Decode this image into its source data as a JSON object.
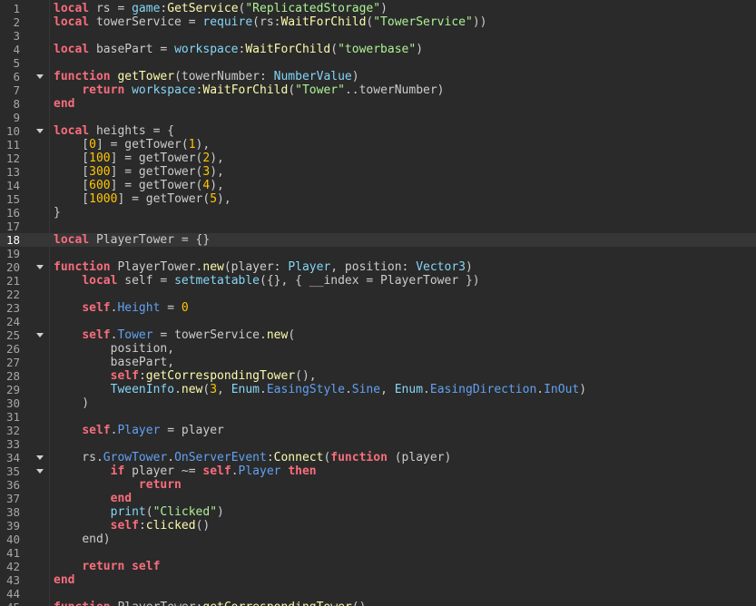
{
  "editor": {
    "current_line": 18,
    "lines": [
      {
        "n": "1",
        "tokens": [
          [
            "kw",
            "local"
          ],
          [
            "plain",
            " rs = "
          ],
          [
            "bi",
            "game"
          ],
          [
            "op",
            ":"
          ],
          [
            "meth",
            "GetService"
          ],
          [
            "plain",
            "("
          ],
          [
            "str",
            "\"ReplicatedStorage\""
          ],
          [
            "plain",
            ")"
          ]
        ]
      },
      {
        "n": "2",
        "tokens": [
          [
            "kw",
            "local"
          ],
          [
            "plain",
            " towerService = "
          ],
          [
            "bi",
            "require"
          ],
          [
            "plain",
            "(rs:"
          ],
          [
            "meth",
            "WaitForChild"
          ],
          [
            "plain",
            "("
          ],
          [
            "str",
            "\"TowerService\""
          ],
          [
            "plain",
            "))"
          ]
        ]
      },
      {
        "n": "3",
        "tokens": []
      },
      {
        "n": "4",
        "tokens": [
          [
            "kw",
            "local"
          ],
          [
            "plain",
            " basePart = "
          ],
          [
            "bi",
            "workspace"
          ],
          [
            "op",
            ":"
          ],
          [
            "meth",
            "WaitForChild"
          ],
          [
            "plain",
            "("
          ],
          [
            "str",
            "\"towerbase\""
          ],
          [
            "plain",
            ")"
          ]
        ]
      },
      {
        "n": "5",
        "tokens": []
      },
      {
        "n": "6",
        "fold": true,
        "tokens": [
          [
            "kw",
            "function"
          ],
          [
            "plain",
            " "
          ],
          [
            "fn",
            "getTower"
          ],
          [
            "plain",
            "(towerNumber: "
          ],
          [
            "type",
            "NumberValue"
          ],
          [
            "plain",
            ")"
          ]
        ]
      },
      {
        "n": "7",
        "tokens": [
          [
            "plain",
            "    "
          ],
          [
            "kw",
            "return"
          ],
          [
            "plain",
            " "
          ],
          [
            "bi",
            "workspace"
          ],
          [
            "op",
            ":"
          ],
          [
            "meth",
            "WaitForChild"
          ],
          [
            "plain",
            "("
          ],
          [
            "str",
            "\"Tower\""
          ],
          [
            "plain",
            "..towerNumber)"
          ]
        ]
      },
      {
        "n": "8",
        "tokens": [
          [
            "kw",
            "end"
          ]
        ]
      },
      {
        "n": "9",
        "tokens": []
      },
      {
        "n": "10",
        "fold": true,
        "tokens": [
          [
            "kw",
            "local"
          ],
          [
            "plain",
            " heights = {"
          ]
        ]
      },
      {
        "n": "11",
        "tokens": [
          [
            "plain",
            "    ["
          ],
          [
            "num",
            "0"
          ],
          [
            "plain",
            "] = getTower("
          ],
          [
            "num",
            "1"
          ],
          [
            "plain",
            "),"
          ]
        ]
      },
      {
        "n": "12",
        "tokens": [
          [
            "plain",
            "    ["
          ],
          [
            "num",
            "100"
          ],
          [
            "plain",
            "] = getTower("
          ],
          [
            "num",
            "2"
          ],
          [
            "plain",
            "),"
          ]
        ]
      },
      {
        "n": "13",
        "tokens": [
          [
            "plain",
            "    ["
          ],
          [
            "num",
            "300"
          ],
          [
            "plain",
            "] = getTower("
          ],
          [
            "num",
            "3"
          ],
          [
            "plain",
            "),"
          ]
        ]
      },
      {
        "n": "14",
        "tokens": [
          [
            "plain",
            "    ["
          ],
          [
            "num",
            "600"
          ],
          [
            "plain",
            "] = getTower("
          ],
          [
            "num",
            "4"
          ],
          [
            "plain",
            "),"
          ]
        ]
      },
      {
        "n": "15",
        "tokens": [
          [
            "plain",
            "    ["
          ],
          [
            "num",
            "1000"
          ],
          [
            "plain",
            "] = getTower("
          ],
          [
            "num",
            "5"
          ],
          [
            "plain",
            "),"
          ]
        ]
      },
      {
        "n": "16",
        "tokens": [
          [
            "plain",
            "}"
          ]
        ]
      },
      {
        "n": "17",
        "tokens": []
      },
      {
        "n": "18",
        "tokens": [
          [
            "kw",
            "local"
          ],
          [
            "plain",
            " PlayerTower = {}"
          ]
        ]
      },
      {
        "n": "19",
        "tokens": []
      },
      {
        "n": "20",
        "fold": true,
        "tokens": [
          [
            "kw",
            "function"
          ],
          [
            "plain",
            " PlayerTower."
          ],
          [
            "fn",
            "new"
          ],
          [
            "plain",
            "(player: "
          ],
          [
            "type",
            "Player"
          ],
          [
            "plain",
            ", position: "
          ],
          [
            "type",
            "Vector3"
          ],
          [
            "plain",
            ")"
          ]
        ]
      },
      {
        "n": "21",
        "tokens": [
          [
            "plain",
            "    "
          ],
          [
            "kw",
            "local"
          ],
          [
            "plain",
            " self = "
          ],
          [
            "bi",
            "setmetatable"
          ],
          [
            "plain",
            "({}, { __index = PlayerTower })"
          ]
        ]
      },
      {
        "n": "22",
        "tokens": []
      },
      {
        "n": "23",
        "tokens": [
          [
            "plain",
            "    "
          ],
          [
            "self",
            "self"
          ],
          [
            "plain",
            "."
          ],
          [
            "prop",
            "Height"
          ],
          [
            "plain",
            " = "
          ],
          [
            "num",
            "0"
          ]
        ]
      },
      {
        "n": "24",
        "tokens": []
      },
      {
        "n": "25",
        "fold": true,
        "tokens": [
          [
            "plain",
            "    "
          ],
          [
            "self",
            "self"
          ],
          [
            "plain",
            "."
          ],
          [
            "prop",
            "Tower"
          ],
          [
            "plain",
            " = towerService."
          ],
          [
            "fn",
            "new"
          ],
          [
            "plain",
            "("
          ]
        ]
      },
      {
        "n": "26",
        "tokens": [
          [
            "plain",
            "        position,"
          ]
        ]
      },
      {
        "n": "27",
        "tokens": [
          [
            "plain",
            "        basePart,"
          ]
        ]
      },
      {
        "n": "28",
        "tokens": [
          [
            "plain",
            "        "
          ],
          [
            "self",
            "self"
          ],
          [
            "plain",
            ":"
          ],
          [
            "fn",
            "getCorrespondingTower"
          ],
          [
            "plain",
            "(),"
          ]
        ]
      },
      {
        "n": "29",
        "tokens": [
          [
            "plain",
            "        "
          ],
          [
            "bi",
            "TweenInfo"
          ],
          [
            "plain",
            "."
          ],
          [
            "meth",
            "new"
          ],
          [
            "plain",
            "("
          ],
          [
            "num",
            "3"
          ],
          [
            "plain",
            ", "
          ],
          [
            "bi",
            "Enum"
          ],
          [
            "plain",
            "."
          ],
          [
            "prop",
            "EasingStyle"
          ],
          [
            "plain",
            "."
          ],
          [
            "prop",
            "Sine"
          ],
          [
            "plain",
            ", "
          ],
          [
            "bi",
            "Enum"
          ],
          [
            "plain",
            "."
          ],
          [
            "prop",
            "EasingDirection"
          ],
          [
            "plain",
            "."
          ],
          [
            "prop",
            "InOut"
          ],
          [
            "plain",
            ")"
          ]
        ]
      },
      {
        "n": "30",
        "tokens": [
          [
            "plain",
            "    )"
          ]
        ]
      },
      {
        "n": "31",
        "tokens": []
      },
      {
        "n": "32",
        "tokens": [
          [
            "plain",
            "    "
          ],
          [
            "self",
            "self"
          ],
          [
            "plain",
            "."
          ],
          [
            "prop",
            "Player"
          ],
          [
            "plain",
            " = player"
          ]
        ]
      },
      {
        "n": "33",
        "tokens": []
      },
      {
        "n": "34",
        "fold": true,
        "tokens": [
          [
            "plain",
            "    rs."
          ],
          [
            "prop",
            "GrowTower"
          ],
          [
            "plain",
            "."
          ],
          [
            "prop",
            "OnServerEvent"
          ],
          [
            "op",
            ":"
          ],
          [
            "meth",
            "Connect"
          ],
          [
            "plain",
            "("
          ],
          [
            "kw",
            "function"
          ],
          [
            "plain",
            " (player)"
          ]
        ]
      },
      {
        "n": "35",
        "fold": true,
        "tokens": [
          [
            "plain",
            "        "
          ],
          [
            "kw",
            "if"
          ],
          [
            "plain",
            " player ~= "
          ],
          [
            "self",
            "self"
          ],
          [
            "plain",
            "."
          ],
          [
            "prop",
            "Player"
          ],
          [
            "plain",
            " "
          ],
          [
            "kw",
            "then"
          ]
        ]
      },
      {
        "n": "36",
        "tokens": [
          [
            "plain",
            "            "
          ],
          [
            "kw",
            "return"
          ]
        ]
      },
      {
        "n": "37",
        "tokens": [
          [
            "plain",
            "        "
          ],
          [
            "kw",
            "end"
          ]
        ]
      },
      {
        "n": "38",
        "tokens": [
          [
            "plain",
            "        "
          ],
          [
            "bi",
            "print"
          ],
          [
            "plain",
            "("
          ],
          [
            "str",
            "\"Clicked\""
          ],
          [
            "plain",
            ")"
          ]
        ]
      },
      {
        "n": "39",
        "tokens": [
          [
            "plain",
            "        "
          ],
          [
            "self",
            "self"
          ],
          [
            "plain",
            ":"
          ],
          [
            "fn",
            "clicked"
          ],
          [
            "plain",
            "()"
          ]
        ]
      },
      {
        "n": "40",
        "tokens": [
          [
            "plain",
            "    "
          ],
          [
            "plain",
            "end)"
          ]
        ]
      },
      {
        "n": "41",
        "tokens": []
      },
      {
        "n": "42",
        "tokens": [
          [
            "plain",
            "    "
          ],
          [
            "kw",
            "return"
          ],
          [
            "plain",
            " "
          ],
          [
            "self",
            "self"
          ]
        ]
      },
      {
        "n": "43",
        "tokens": [
          [
            "kw",
            "end"
          ]
        ]
      },
      {
        "n": "44",
        "tokens": []
      },
      {
        "n": "45",
        "tokens": [
          [
            "kw",
            "function"
          ],
          [
            "plain",
            " PlayerTower:"
          ],
          [
            "fn",
            "getCorrespondingTower"
          ],
          [
            "plain",
            "()"
          ]
        ]
      }
    ]
  },
  "colors": {
    "background": "#2a2a2a",
    "current_line": "#363636",
    "keyword": "#f86d7c",
    "number": "#ffc600",
    "string": "#adf195",
    "builtin": "#84d6f7",
    "method": "#fdfbac",
    "property": "#61a1f1",
    "text": "#cccccc",
    "line_number": "#a6a6a6"
  },
  "icons": {
    "fold": "chevron-down-icon"
  }
}
